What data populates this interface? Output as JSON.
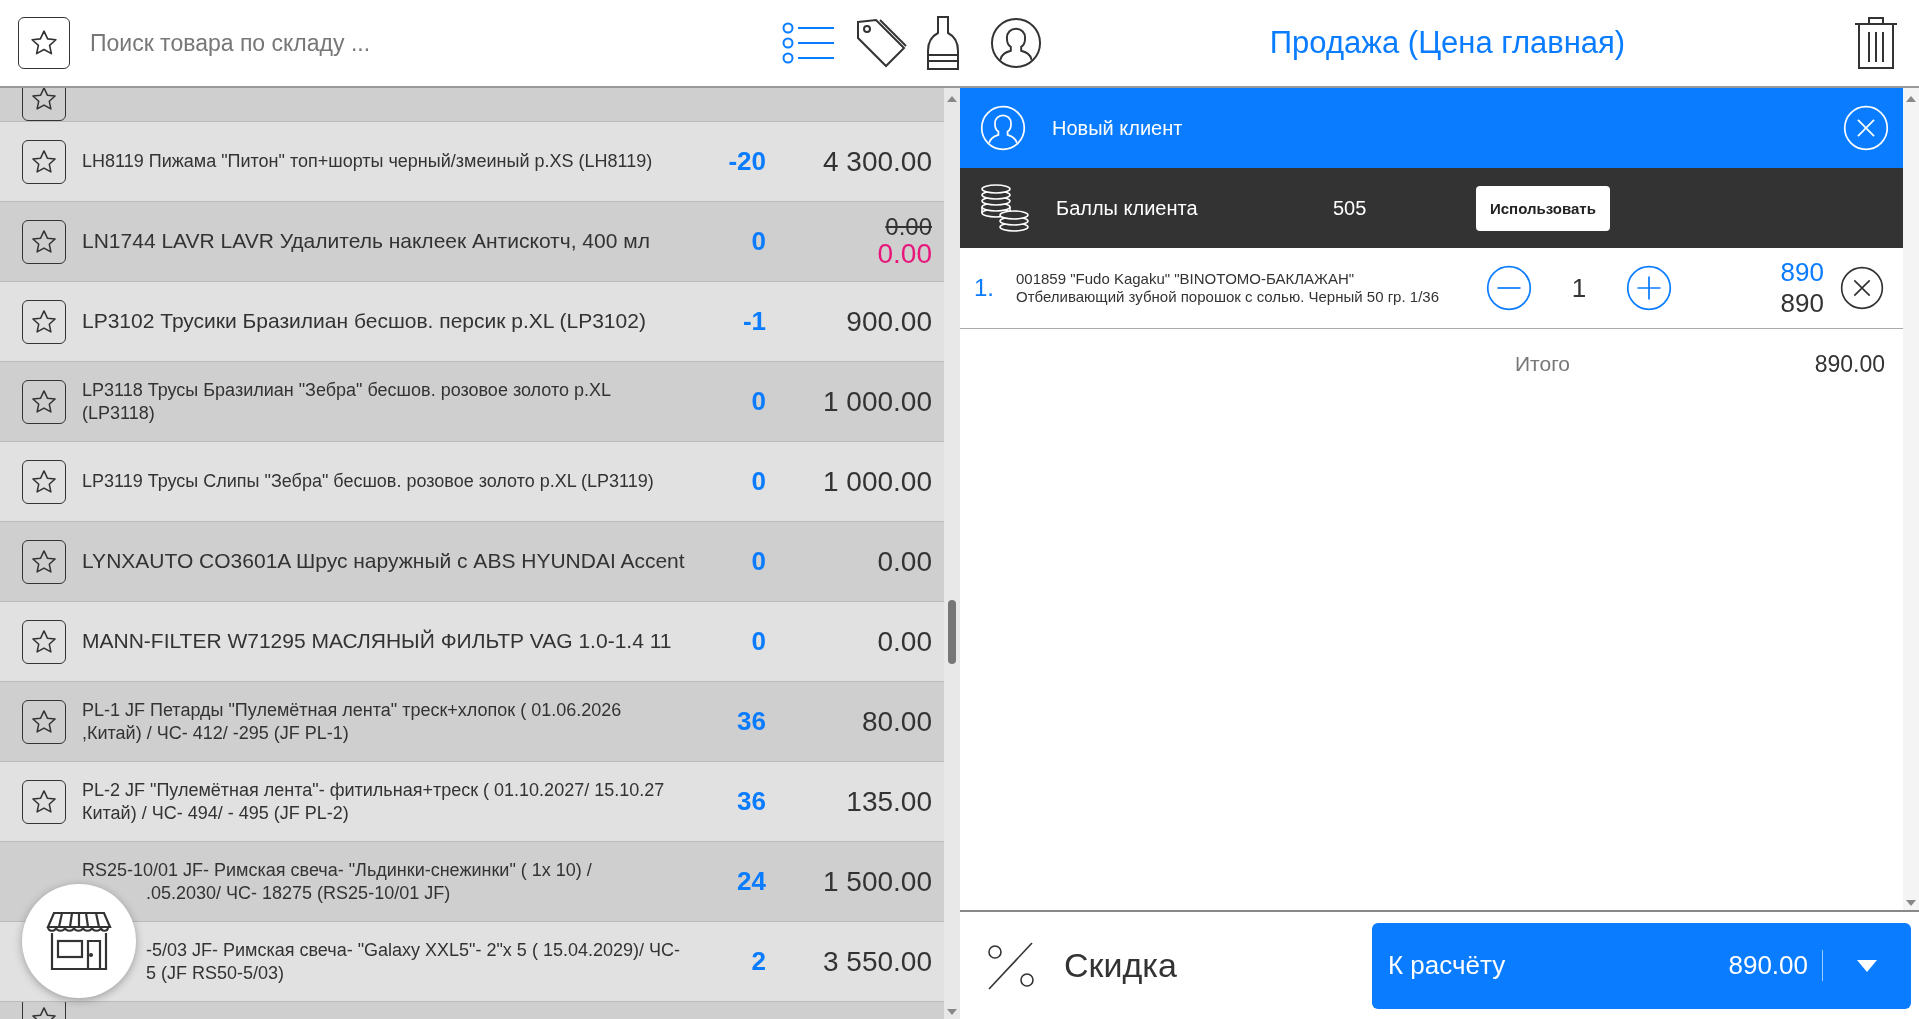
{
  "search": {
    "placeholder": "Поиск товара по складу ..."
  },
  "products": [
    {
      "kind": "cut"
    },
    {
      "kind": "plain",
      "lines": [
        {
          "text": "LH8119 Пижама \"Питон\" топ+шорты черный/змеиный р.XS (LH8119)",
          "covered": false
        }
      ],
      "qty": "-20",
      "price": "4 300.00"
    },
    {
      "kind": "discounted",
      "lines": [
        {
          "text": "LN1744 LAVR LAVR Удалитель наклеек Антискотч, 400 мл",
          "covered": false
        }
      ],
      "qty": "0",
      "old_price": "0.00",
      "price": "0.00"
    },
    {
      "kind": "plain",
      "lines": [
        {
          "text": "LP3102 Трусики Бразилиан бесшов. персик р.XL (LP3102)",
          "covered": false
        }
      ],
      "qty": "-1",
      "price": "900.00"
    },
    {
      "kind": "plain",
      "lines": [
        {
          "text": "LP3118 Трусы Бразилиан \"Зебра\" бесшов. розовое золото р.XL",
          "covered": false
        },
        {
          "text": "(LP3118)",
          "covered": false
        }
      ],
      "qty": "0",
      "price": "1 000.00"
    },
    {
      "kind": "plain",
      "lines": [
        {
          "text": "LP3119 Трусы Слипы \"Зебра\" бесшов. розовое золото р.XL (LP3119)",
          "covered": false
        }
      ],
      "qty": "0",
      "price": "1 000.00"
    },
    {
      "kind": "plain",
      "lines": [
        {
          "text": "LYNXAUTO CO3601A Шрус наружный с ABS HYUNDAI Accent",
          "covered": false
        }
      ],
      "qty": "0",
      "price": "0.00"
    },
    {
      "kind": "plain",
      "lines": [
        {
          "text": "MANN-FILTER W71295 МАСЛЯНЫЙ ФИЛЬТР VAG 1.0-1.4 11",
          "covered": false
        }
      ],
      "qty": "0",
      "price": "0.00"
    },
    {
      "kind": "plain",
      "lines": [
        {
          "text": "PL-1 JF Петарды \"Пулемётная лента\" треск+хлопок ( 01.06.2026",
          "covered": false
        },
        {
          "text": ",Китай) / ЧС- 412/ -295 (JF PL-1)",
          "covered": false
        }
      ],
      "qty": "36",
      "price": "80.00"
    },
    {
      "kind": "plain",
      "lines": [
        {
          "text": "PL-2 JF \"Пулемётная лента\"- фитильная+треск ( 01.10.2027/ 15.10.27",
          "covered": false
        },
        {
          "text": "Китай) / ЧС- 494/ - 495 (JF PL-2)",
          "covered": false
        }
      ],
      "qty": "36",
      "price": "135.00"
    },
    {
      "kind": "plain",
      "lines": [
        {
          "text": "RS25-10/01 JF- Римская свеча- \"Льдинки-снежинки\" ( 1x 10) /",
          "covered": false
        },
        {
          "text": ".05.2030/ ЧС- 18275 (RS25-10/01 JF)",
          "covered": true
        }
      ],
      "qty": "24",
      "price": "1 500.00"
    },
    {
      "kind": "plain",
      "lines": [
        {
          "text": "-5/03 JF- Римская свеча- \"Galaxy XXL5\"- 2\"x 5 ( 15.04.2029)/ ЧС-",
          "covered": true
        },
        {
          "text": "5 (JF RS50-5/03)",
          "covered": true
        }
      ],
      "qty": "2",
      "price": "3 550.00"
    },
    {
      "kind": "cut"
    }
  ],
  "sale": {
    "title": "Продажа (Цена главная)",
    "client": {
      "name": "Новый клиент"
    },
    "points": {
      "label": "Баллы клиента",
      "value": "505",
      "button": "Использовать"
    },
    "items": [
      {
        "index": "1.",
        "code": "001859 \"Fudo Kagaku\" \"BINOTOMO-БАКЛАЖАН\"",
        "description": "Отбеливающий зубной порошок с солью. Черный 50 гр. 1/36",
        "qty": "1",
        "price": "890",
        "total": "890"
      }
    ],
    "total": {
      "label": "Итого",
      "value": "890.00"
    },
    "discount": {
      "label": "Скидка"
    },
    "checkout": {
      "label": "К расчёту",
      "amount": "890.00"
    }
  }
}
